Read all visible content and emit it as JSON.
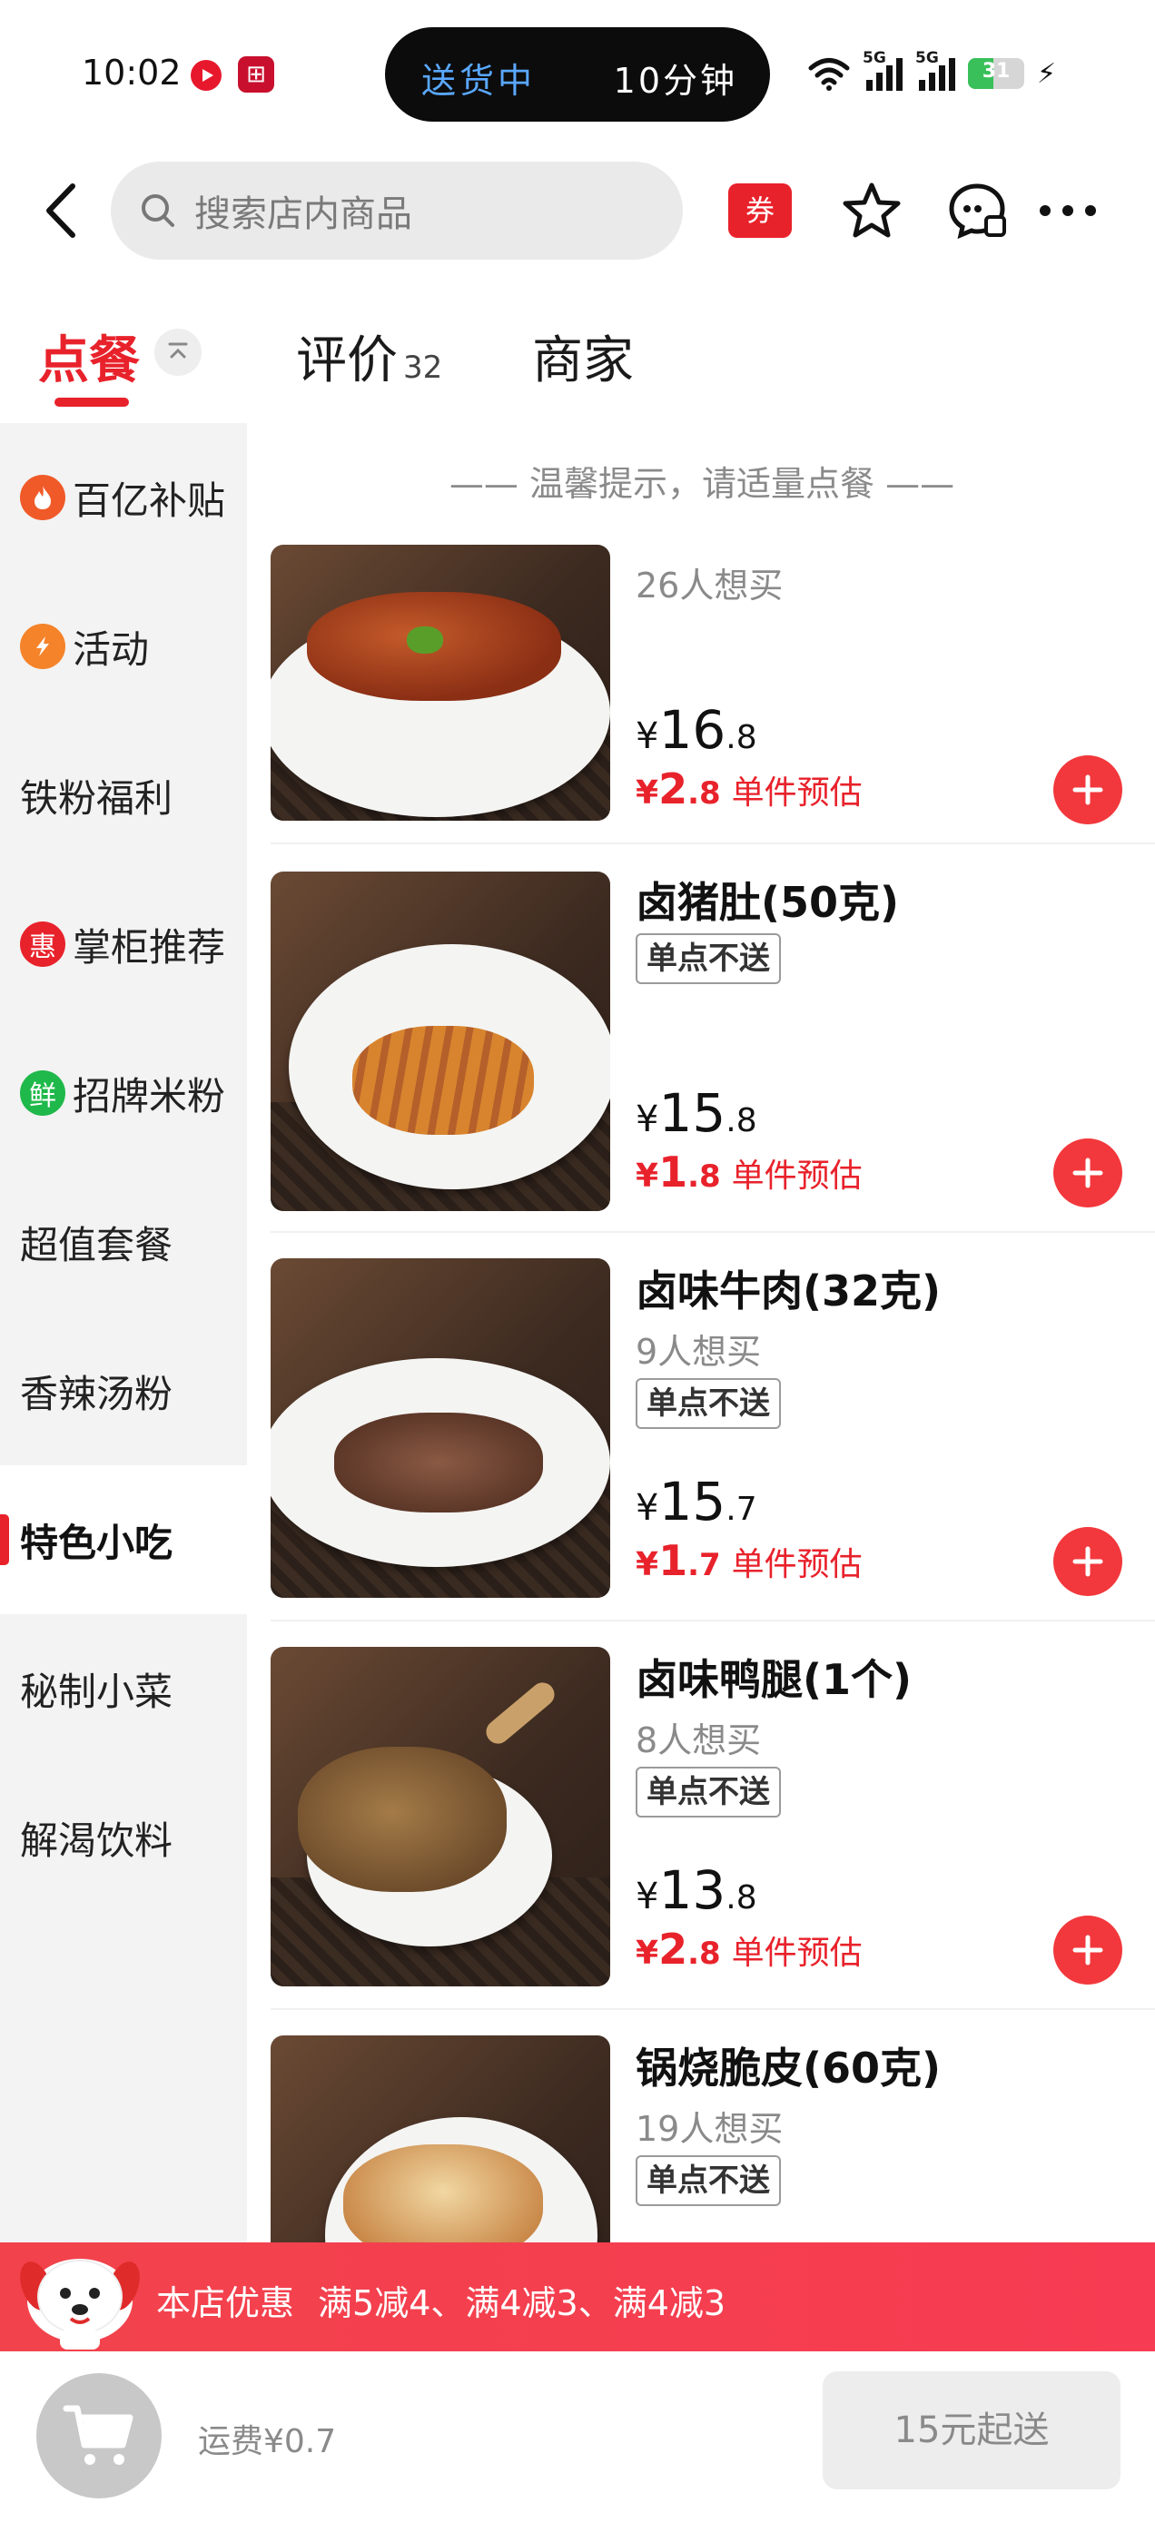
{
  "status_bar": {
    "time": "10:02",
    "island_left": "送货中",
    "island_right": "10分钟",
    "network": "5G",
    "battery": "31",
    "icons": [
      "video-app-icon",
      "app-icon",
      "wifi-icon",
      "signal-icon",
      "battery-icon",
      "charging-icon"
    ]
  },
  "header": {
    "search_placeholder": "搜索店内商品",
    "coupon_label": "券",
    "icons": [
      "back-arrow-icon",
      "search-icon",
      "star-icon",
      "chat-icon",
      "more-icon"
    ]
  },
  "tabs": [
    {
      "label": "点餐",
      "count": "",
      "active": true
    },
    {
      "label": "评价",
      "count": "32",
      "active": false
    },
    {
      "label": "商家",
      "count": "",
      "active": false
    }
  ],
  "notice": "—— 温馨提示，请适量点餐 ——",
  "sidebar": {
    "items": [
      {
        "label": "百亿补贴",
        "icon": "flame-icon",
        "icon_text": "",
        "icon_color": "#f05a28"
      },
      {
        "label": "活动",
        "icon": "tag-icon",
        "icon_text": "",
        "icon_color": "#f5832a"
      },
      {
        "label": "铁粉福利",
        "icon": "",
        "icon_text": "",
        "icon_color": ""
      },
      {
        "label": "掌柜推荐",
        "icon": "hui-badge-icon",
        "icon_text": "惠",
        "icon_color": "#e8222b"
      },
      {
        "label": "招牌米粉",
        "icon": "xian-badge-icon",
        "icon_text": "鲜",
        "icon_color": "#1fb84a"
      },
      {
        "label": "超值套餐",
        "icon": "",
        "icon_text": "",
        "icon_color": ""
      },
      {
        "label": "香辣汤粉",
        "icon": "",
        "icon_text": "",
        "icon_color": ""
      },
      {
        "label": "特色小吃",
        "icon": "",
        "icon_text": "",
        "icon_color": "",
        "active": true
      },
      {
        "label": "秘制小菜",
        "icon": "",
        "icon_text": "",
        "icon_color": ""
      },
      {
        "label": "解渴饮料",
        "icon": "",
        "icon_text": "",
        "icon_color": ""
      }
    ]
  },
  "products": [
    {
      "name": "",
      "want": "26人想买",
      "tag": "",
      "price_int": "16",
      "price_dec": ".8",
      "est_int": "2",
      "est_dec": ".8",
      "est_label": "单件预估",
      "image": "braised-pork-trotter-photo"
    },
    {
      "name": "卤猪肚(50克)",
      "want": "",
      "tag": "单点不送",
      "price_int": "15",
      "price_dec": ".8",
      "est_int": "1",
      "est_dec": ".8",
      "est_label": "单件预估",
      "image": "braised-pork-tripe-photo"
    },
    {
      "name": "卤味牛肉(32克)",
      "want": "9人想买",
      "tag": "单点不送",
      "price_int": "15",
      "price_dec": ".7",
      "est_int": "1",
      "est_dec": ".7",
      "est_label": "单件预估",
      "image": "braised-beef-photo"
    },
    {
      "name": "卤味鸭腿(1个)",
      "want": "8人想买",
      "tag": "单点不送",
      "price_int": "13",
      "price_dec": ".8",
      "est_int": "2",
      "est_dec": ".8",
      "est_label": "单件预估",
      "image": "braised-duck-leg-photo"
    },
    {
      "name": "锅烧脆皮(60克)",
      "want": "19人想买",
      "tag": "单点不送",
      "price_int": "",
      "price_dec": "",
      "est_int": "",
      "est_dec": "",
      "est_label": "",
      "image": "crispy-pork-photo"
    }
  ],
  "currency": "¥",
  "promo": {
    "title": "本店优惠",
    "deals": "满5减4、满4减3、满4减3"
  },
  "bottom": {
    "delivery_fee": "运费¥0.7",
    "min_order": "15元起送"
  },
  "colors": {
    "accent": "#e8222b",
    "sidebar_bg": "#f3f3f3",
    "promo_bg": "#f2434c"
  }
}
